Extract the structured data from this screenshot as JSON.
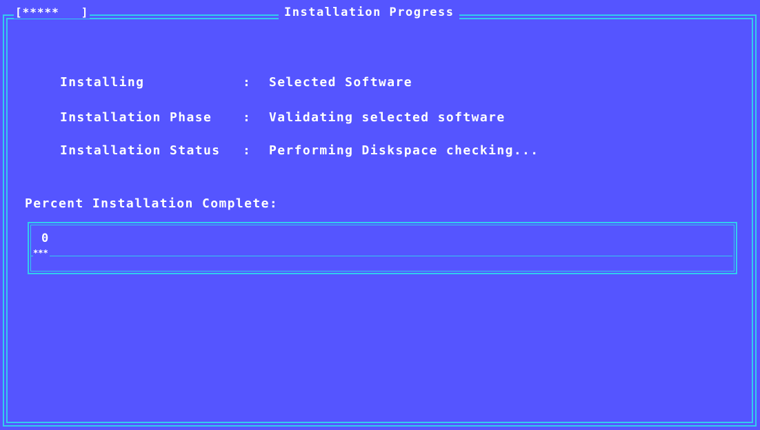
{
  "window": {
    "title": "Installation Progress",
    "spinner": "[*****   ]"
  },
  "details": [
    {
      "label": "Installing",
      "separator": ":",
      "value": "Selected Software"
    },
    {
      "label": "Installation Phase",
      "separator": ":",
      "value": "Validating selected software"
    },
    {
      "label": "Installation Status",
      "separator": ":",
      "value": "Performing Diskspace checking..."
    }
  ],
  "progress": {
    "label": "Percent Installation Complete:",
    "value": "0",
    "bar": "***",
    "percent": 0
  },
  "colors": {
    "background": "#5555ff",
    "border": "#33ccee",
    "text": "#ffffff"
  }
}
